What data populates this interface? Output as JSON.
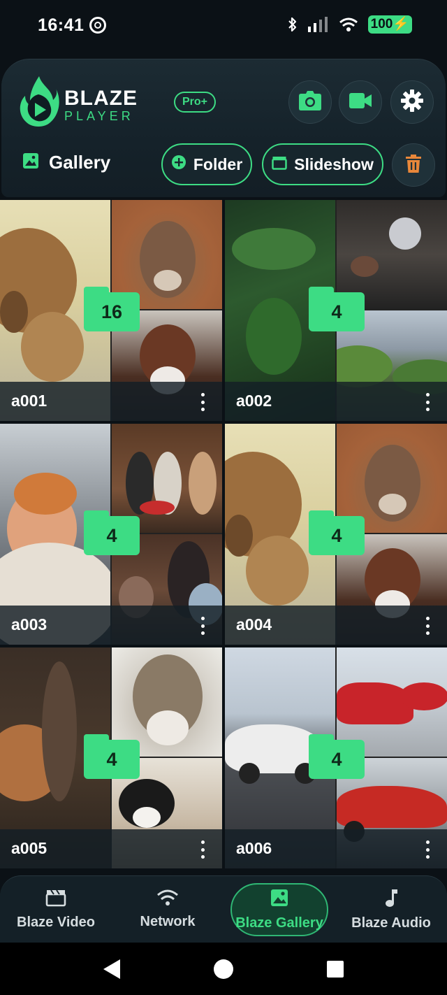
{
  "status_bar": {
    "time": "16:41",
    "battery": "100"
  },
  "header": {
    "app_name": "BLAZE",
    "app_sub": "PLAYER",
    "pro_badge": "Pro+",
    "title": "Gallery",
    "folder_button": "Folder",
    "slideshow_button": "Slideshow"
  },
  "folders": [
    {
      "name": "a001",
      "count": "16"
    },
    {
      "name": "a002",
      "count": "4"
    },
    {
      "name": "a003",
      "count": "4"
    },
    {
      "name": "a004",
      "count": "4"
    },
    {
      "name": "a005",
      "count": "4"
    },
    {
      "name": "a006",
      "count": "4"
    }
  ],
  "bottom_nav": {
    "items": [
      {
        "label": "Blaze Video",
        "icon": "clapperboard-icon"
      },
      {
        "label": "Network",
        "icon": "wifi-icon"
      },
      {
        "label": "Blaze Gallery",
        "icon": "image-icon"
      },
      {
        "label": "Blaze Audio",
        "icon": "music-note-icon"
      }
    ],
    "active": "Blaze Gallery"
  },
  "colors": {
    "accent": "#3ddc84",
    "background": "#0b1116",
    "card": "#17262d"
  }
}
